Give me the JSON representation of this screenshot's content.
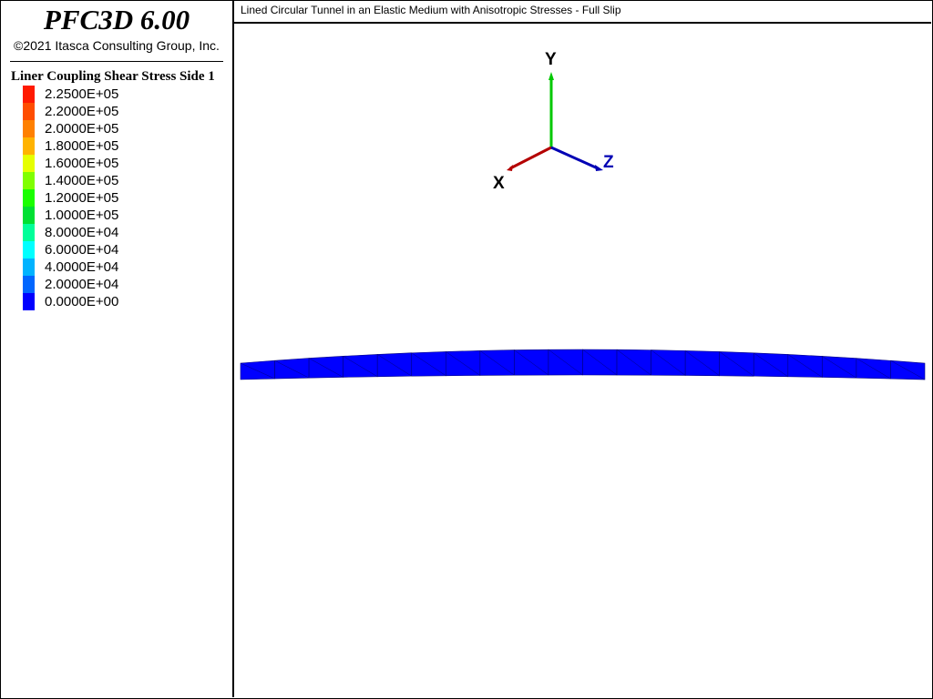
{
  "app": {
    "title": "PFC3D 6.00",
    "copyright": "©2021 Itasca Consulting Group, Inc."
  },
  "plot": {
    "title": "Lined Circular Tunnel in an Elastic Medium with Anisotropic Stresses - Full Slip"
  },
  "legend": {
    "title": "Liner Coupling Shear Stress Side 1",
    "items": [
      {
        "label": "2.2500E+05",
        "color": "#ff1a00"
      },
      {
        "label": "2.2000E+05",
        "color": "#ff4d00"
      },
      {
        "label": "2.0000E+05",
        "color": "#ff8000"
      },
      {
        "label": "1.8000E+05",
        "color": "#ffb300"
      },
      {
        "label": "1.6000E+05",
        "color": "#e6ff00"
      },
      {
        "label": "1.4000E+05",
        "color": "#80ff00"
      },
      {
        "label": "1.2000E+05",
        "color": "#1aff00"
      },
      {
        "label": "1.0000E+05",
        "color": "#00e033"
      },
      {
        "label": "8.0000E+04",
        "color": "#00ff99"
      },
      {
        "label": "6.0000E+04",
        "color": "#00ffff"
      },
      {
        "label": "4.0000E+04",
        "color": "#00b3ff"
      },
      {
        "label": "2.0000E+04",
        "color": "#0066ff"
      },
      {
        "label": "0.0000E+00",
        "color": "#0000ff"
      }
    ]
  },
  "axes": {
    "x_label": "X",
    "y_label": "Y",
    "z_label": "Z",
    "x_color": "#b40000",
    "y_color": "#00c800",
    "z_color": "#0000b4"
  },
  "liner": {
    "color": "#0000ff",
    "edge_color": "#000080"
  }
}
